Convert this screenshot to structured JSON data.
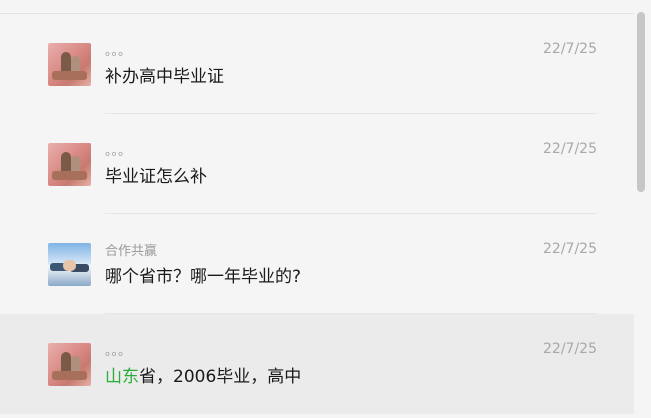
{
  "messages": [
    {
      "avatar_icon": "user-photo-avatar-icon",
      "sender": "。。。",
      "date": "22/7/25",
      "text": "补办高中毕业证",
      "highlight": "",
      "text_rest": ""
    },
    {
      "avatar_icon": "user-photo-avatar-icon",
      "sender": "。。。",
      "date": "22/7/25",
      "text": "毕业证怎么补",
      "highlight": "",
      "text_rest": ""
    },
    {
      "avatar_icon": "handshake-avatar-icon",
      "sender": "合作共赢",
      "date": "22/7/25",
      "text": "哪个省市？哪一年毕业的?",
      "highlight": "",
      "text_rest": ""
    },
    {
      "avatar_icon": "user-photo-avatar-icon",
      "sender": "。。。",
      "date": "22/7/25",
      "text": "",
      "highlight": "山东",
      "text_rest": "省，2006毕业，高中"
    }
  ],
  "colors": {
    "background": "#f5f5f5",
    "selected_row": "#ebebeb",
    "link_green": "#2aae3a",
    "meta_gray": "#9a9a9a"
  }
}
